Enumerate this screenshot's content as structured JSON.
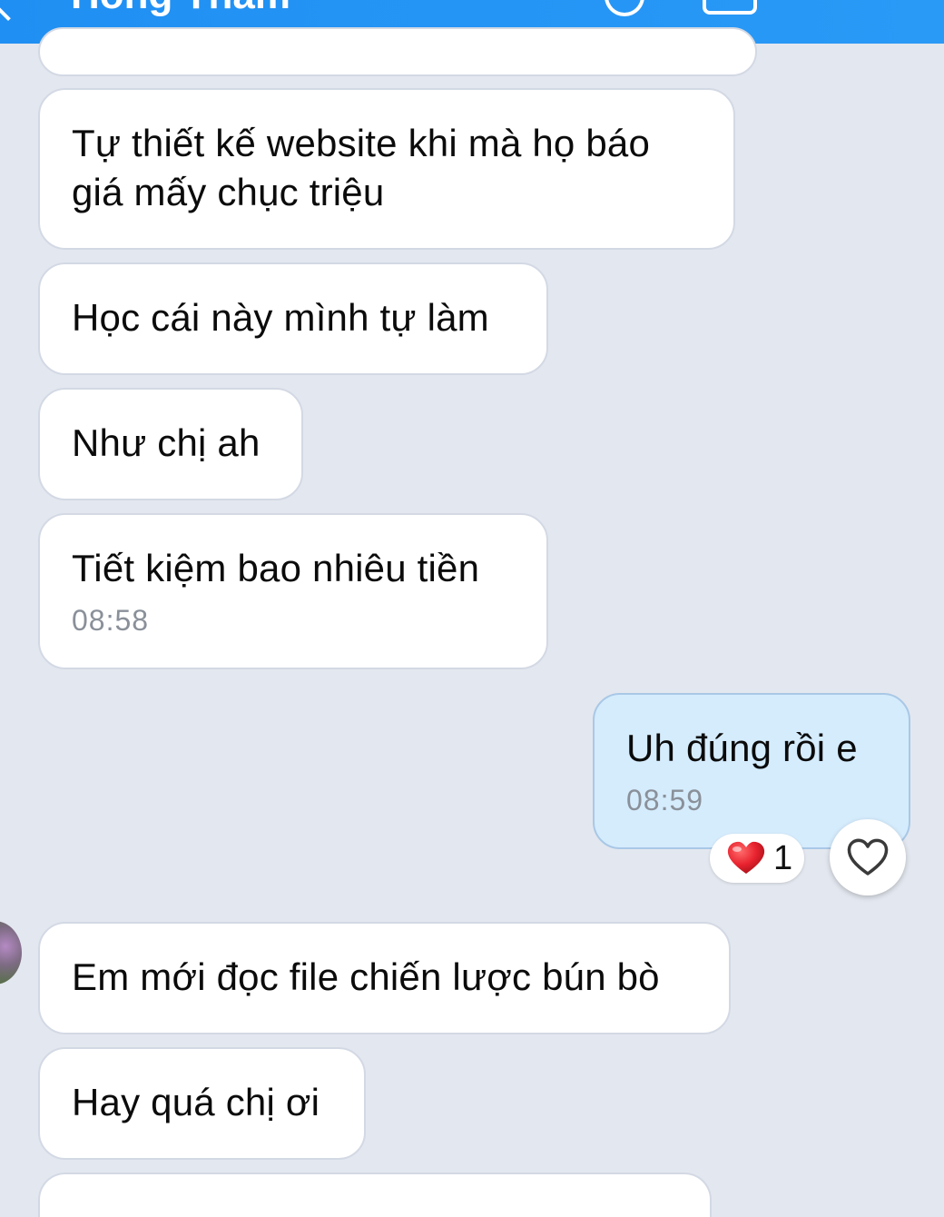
{
  "header": {
    "title": "Hồng Thắm"
  },
  "messages": [
    {
      "id": "m0",
      "text": ""
    },
    {
      "id": "m1",
      "line1": "Tự thiết kế website khi mà họ báo",
      "line2": "giá mấy chục triệu"
    },
    {
      "id": "m2",
      "text": "Học cái này mình tự làm"
    },
    {
      "id": "m3",
      "text": "Như chị ah"
    },
    {
      "id": "m4",
      "text": "Tiết kiệm bao nhiêu tiền",
      "time": "08:58"
    },
    {
      "id": "m5",
      "text": "Uh đúng rồi e",
      "time": "08:59",
      "sent": true
    },
    {
      "id": "m6",
      "text": "Em mới đọc file chiến lược bún bò"
    },
    {
      "id": "m7",
      "text": "Hay quá chị ơi"
    },
    {
      "id": "m8",
      "text": ""
    }
  ],
  "reaction": {
    "icon": "red-heart-icon",
    "count": "1"
  },
  "react_button": {
    "icon": "heart-outline-icon"
  },
  "colors": {
    "header": "#2a9af7",
    "background": "#e3e7ef",
    "sent_bubble": "#d5ecfd",
    "received_bubble": "#ffffff",
    "heart": "#e8232f"
  }
}
